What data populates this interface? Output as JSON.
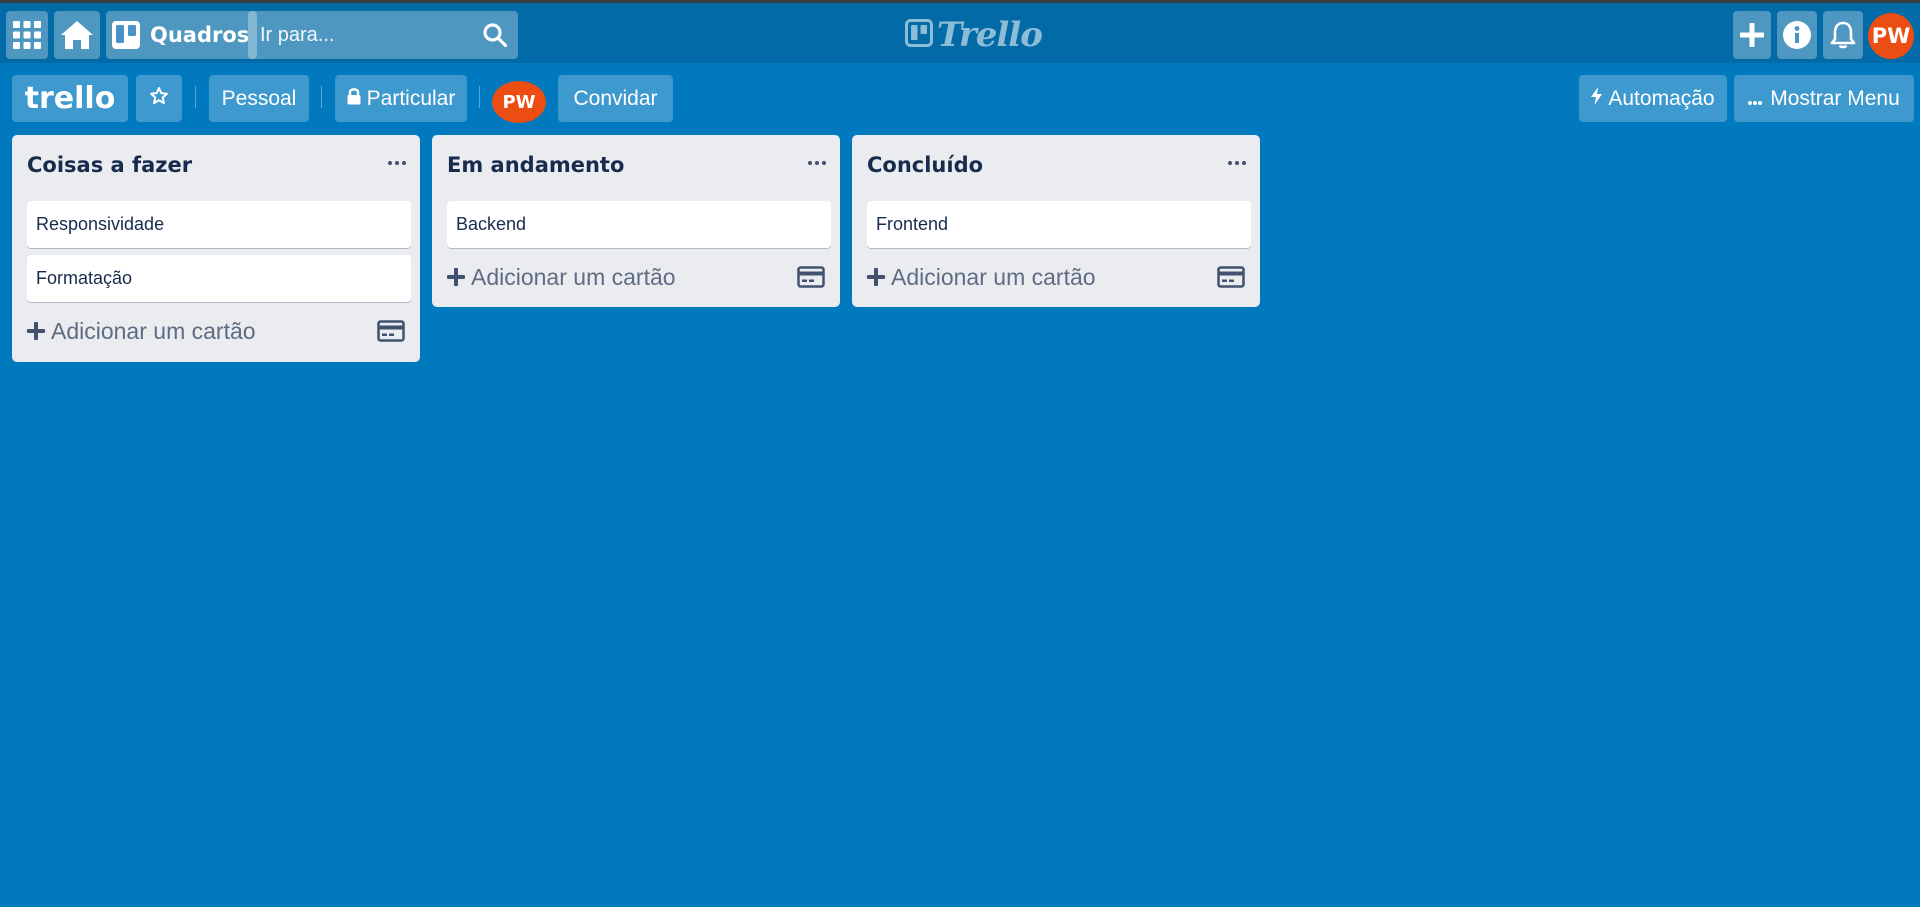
{
  "topbar": {
    "boards_label": "Quadros",
    "search_placeholder": "Ir para...",
    "logo_text": "Trello",
    "user_initials": "PW"
  },
  "board": {
    "title": "trello",
    "team": "Pessoal",
    "visibility": "Particular",
    "member_initials": "PW",
    "invite_label": "Convidar",
    "automation_label": "Automação",
    "menu_label": "Mostrar Menu"
  },
  "lists": [
    {
      "title": "Coisas a fazer",
      "cards": [
        "Responsividade",
        "Formatação"
      ],
      "add_label": "Adicionar um cartão"
    },
    {
      "title": "Em andamento",
      "cards": [
        "Backend"
      ],
      "add_label": "Adicionar um cartão"
    },
    {
      "title": "Concluído",
      "cards": [
        "Frontend"
      ],
      "add_label": "Adicionar um cartão"
    }
  ],
  "colors": {
    "board_bg": "#0079bf",
    "topbar_bg": "#026aa7",
    "list_bg": "#ebecf0",
    "avatar": "#eb4d12"
  }
}
